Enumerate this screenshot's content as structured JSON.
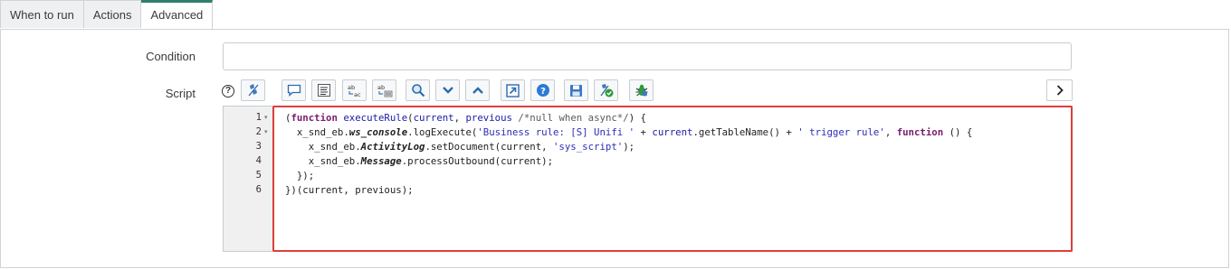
{
  "tabs": [
    {
      "label": "When to run"
    },
    {
      "label": "Actions"
    },
    {
      "label": "Advanced"
    }
  ],
  "form": {
    "condition_label": "Condition",
    "condition_value": "",
    "script_label": "Script",
    "help_glyph": "?"
  },
  "toolbar": {
    "icons": [
      "help-icon",
      "toggle-syntax-icon",
      "comment-icon",
      "format-icon",
      "replace-icon",
      "replace-all-icon",
      "search-icon",
      "next-icon",
      "previous-icon",
      "fullscreen-icon",
      "script-help-icon",
      "save-icon",
      "syntax-check-icon",
      "debug-icon",
      "expand-chevron-icon"
    ]
  },
  "editor": {
    "line_numbers": [
      "1",
      "2",
      "3",
      "4",
      "5",
      "6"
    ],
    "folds": [
      "▾",
      "▾",
      "",
      "",
      "",
      ""
    ],
    "lines": [
      [
        {
          "t": "(",
          "c": ""
        },
        {
          "t": "function",
          "c": "kw"
        },
        {
          "t": " ",
          "c": ""
        },
        {
          "t": "executeRule",
          "c": "fn"
        },
        {
          "t": "(",
          "c": ""
        },
        {
          "t": "current",
          "c": "fn"
        },
        {
          "t": ", ",
          "c": ""
        },
        {
          "t": "previous",
          "c": "fn"
        },
        {
          "t": " ",
          "c": ""
        },
        {
          "t": "/*null when async*/",
          "c": "cmt"
        },
        {
          "t": ") {",
          "c": ""
        }
      ],
      [
        {
          "t": "  x_snd_eb.",
          "c": ""
        },
        {
          "t": "ws_console",
          "c": "it"
        },
        {
          "t": ".logExecute(",
          "c": ""
        },
        {
          "t": "'Business rule: [S] Unifi '",
          "c": "str"
        },
        {
          "t": " + ",
          "c": ""
        },
        {
          "t": "current",
          "c": "fn"
        },
        {
          "t": ".getTableName() + ",
          "c": ""
        },
        {
          "t": "' trigger rule'",
          "c": "str"
        },
        {
          "t": ", ",
          "c": ""
        },
        {
          "t": "function",
          "c": "kw"
        },
        {
          "t": " () {",
          "c": ""
        }
      ],
      [
        {
          "t": "    x_snd_eb.",
          "c": ""
        },
        {
          "t": "ActivityLog",
          "c": "it"
        },
        {
          "t": ".setDocument(current, ",
          "c": ""
        },
        {
          "t": "'sys_script'",
          "c": "str"
        },
        {
          "t": ");",
          "c": ""
        }
      ],
      [
        {
          "t": "    x_snd_eb.",
          "c": ""
        },
        {
          "t": "Message",
          "c": "it"
        },
        {
          "t": ".processOutbound(current);",
          "c": ""
        }
      ],
      [
        {
          "t": "  });",
          "c": ""
        }
      ],
      [
        {
          "t": "})(current, previous);",
          "c": ""
        }
      ]
    ]
  },
  "colors": {
    "highlight_border": "#dd3e3c",
    "active_tab_accent": "#2f7f6f",
    "keyword": "#7a1b6d",
    "identifier": "#1a1aa6",
    "string": "#2d2db8"
  }
}
